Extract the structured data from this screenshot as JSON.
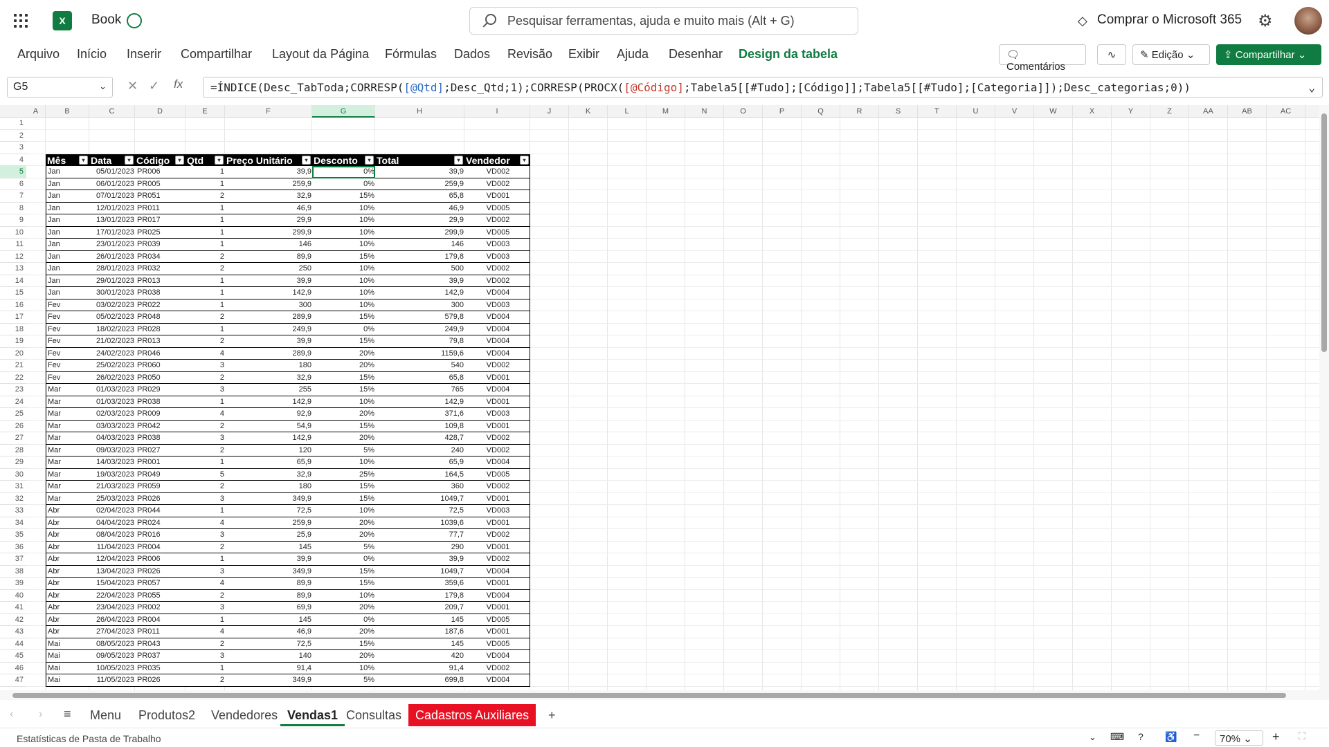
{
  "app": {
    "doc_title": "Book",
    "search_placeholder": "Pesquisar ferramentas, ajuda e muito mais (Alt + G)",
    "buy_label": "Comprar o Microsoft 365"
  },
  "menu": {
    "tabs": [
      "Arquivo",
      "Início",
      "Inserir",
      "Compartilhar",
      "Layout da Página",
      "Fórmulas",
      "Dados",
      "Revisão",
      "Exibir",
      "Ajuda",
      "Desenhar",
      "Design da tabela"
    ],
    "active": "Design da tabela"
  },
  "ribbon": {
    "comments_label": "Comentários",
    "edit_label": "Edição",
    "share_label": "Compartilhar"
  },
  "formula_bar": {
    "name_box": "G5",
    "fx": "fx",
    "formula_parts": [
      "=ÍNDICE(Desc_TabToda;CORRESP(",
      "[@Qtd]",
      ";Desc_Qtd;1);CORRESP(PROCX(",
      "[@Código]",
      ";Tabela5[[#Tudo];[Código]];Tabela5[[#Tudo];[Categoria]]);Desc_categorias;0))"
    ]
  },
  "columns": [
    "A",
    "B",
    "C",
    "D",
    "E",
    "F",
    "G",
    "H",
    "I",
    "J",
    "K",
    "L",
    "M",
    "N",
    "O",
    "P",
    "Q",
    "R",
    "S",
    "T",
    "U",
    "V",
    "W",
    "X",
    "Y",
    "Z",
    "AA",
    "AB",
    "AC"
  ],
  "selected_column": "G",
  "selected_row": 5,
  "table": {
    "headers": [
      "Mês",
      "Data",
      "Código",
      "Qtd",
      "Preço Unitário",
      "Desconto",
      "Total",
      "Vendedor"
    ],
    "rows": [
      [
        "Jan",
        "05/01/2023",
        "PR006",
        "1",
        "39,9",
        "0%",
        "39,9",
        "VD002"
      ],
      [
        "Jan",
        "06/01/2023",
        "PR005",
        "1",
        "259,9",
        "0%",
        "259,9",
        "VD002"
      ],
      [
        "Jan",
        "07/01/2023",
        "PR051",
        "2",
        "32,9",
        "15%",
        "65,8",
        "VD001"
      ],
      [
        "Jan",
        "12/01/2023",
        "PR011",
        "1",
        "46,9",
        "10%",
        "46,9",
        "VD005"
      ],
      [
        "Jan",
        "13/01/2023",
        "PR017",
        "1",
        "29,9",
        "10%",
        "29,9",
        "VD002"
      ],
      [
        "Jan",
        "17/01/2023",
        "PR025",
        "1",
        "299,9",
        "10%",
        "299,9",
        "VD005"
      ],
      [
        "Jan",
        "23/01/2023",
        "PR039",
        "1",
        "146",
        "10%",
        "146",
        "VD003"
      ],
      [
        "Jan",
        "26/01/2023",
        "PR034",
        "2",
        "89,9",
        "15%",
        "179,8",
        "VD003"
      ],
      [
        "Jan",
        "28/01/2023",
        "PR032",
        "2",
        "250",
        "10%",
        "500",
        "VD002"
      ],
      [
        "Jan",
        "29/01/2023",
        "PR013",
        "1",
        "39,9",
        "10%",
        "39,9",
        "VD002"
      ],
      [
        "Jan",
        "30/01/2023",
        "PR038",
        "1",
        "142,9",
        "10%",
        "142,9",
        "VD004"
      ],
      [
        "Fev",
        "03/02/2023",
        "PR022",
        "1",
        "300",
        "10%",
        "300",
        "VD003"
      ],
      [
        "Fev",
        "05/02/2023",
        "PR048",
        "2",
        "289,9",
        "15%",
        "579,8",
        "VD004"
      ],
      [
        "Fev",
        "18/02/2023",
        "PR028",
        "1",
        "249,9",
        "0%",
        "249,9",
        "VD004"
      ],
      [
        "Fev",
        "21/02/2023",
        "PR013",
        "2",
        "39,9",
        "15%",
        "79,8",
        "VD004"
      ],
      [
        "Fev",
        "24/02/2023",
        "PR046",
        "4",
        "289,9",
        "20%",
        "1159,6",
        "VD004"
      ],
      [
        "Fev",
        "25/02/2023",
        "PR060",
        "3",
        "180",
        "20%",
        "540",
        "VD002"
      ],
      [
        "Fev",
        "26/02/2023",
        "PR050",
        "2",
        "32,9",
        "15%",
        "65,8",
        "VD001"
      ],
      [
        "Mar",
        "01/03/2023",
        "PR029",
        "3",
        "255",
        "15%",
        "765",
        "VD004"
      ],
      [
        "Mar",
        "01/03/2023",
        "PR038",
        "1",
        "142,9",
        "10%",
        "142,9",
        "VD001"
      ],
      [
        "Mar",
        "02/03/2023",
        "PR009",
        "4",
        "92,9",
        "20%",
        "371,6",
        "VD003"
      ],
      [
        "Mar",
        "03/03/2023",
        "PR042",
        "2",
        "54,9",
        "15%",
        "109,8",
        "VD001"
      ],
      [
        "Mar",
        "04/03/2023",
        "PR038",
        "3",
        "142,9",
        "20%",
        "428,7",
        "VD002"
      ],
      [
        "Mar",
        "09/03/2023",
        "PR027",
        "2",
        "120",
        "5%",
        "240",
        "VD002"
      ],
      [
        "Mar",
        "14/03/2023",
        "PR001",
        "1",
        "65,9",
        "10%",
        "65,9",
        "VD004"
      ],
      [
        "Mar",
        "19/03/2023",
        "PR049",
        "5",
        "32,9",
        "25%",
        "164,5",
        "VD005"
      ],
      [
        "Mar",
        "21/03/2023",
        "PR059",
        "2",
        "180",
        "15%",
        "360",
        "VD002"
      ],
      [
        "Mar",
        "25/03/2023",
        "PR026",
        "3",
        "349,9",
        "15%",
        "1049,7",
        "VD001"
      ],
      [
        "Abr",
        "02/04/2023",
        "PR044",
        "1",
        "72,5",
        "10%",
        "72,5",
        "VD003"
      ],
      [
        "Abr",
        "04/04/2023",
        "PR024",
        "4",
        "259,9",
        "20%",
        "1039,6",
        "VD001"
      ],
      [
        "Abr",
        "08/04/2023",
        "PR016",
        "3",
        "25,9",
        "20%",
        "77,7",
        "VD002"
      ],
      [
        "Abr",
        "11/04/2023",
        "PR004",
        "2",
        "145",
        "5%",
        "290",
        "VD001"
      ],
      [
        "Abr",
        "12/04/2023",
        "PR006",
        "1",
        "39,9",
        "0%",
        "39,9",
        "VD002"
      ],
      [
        "Abr",
        "13/04/2023",
        "PR026",
        "3",
        "349,9",
        "15%",
        "1049,7",
        "VD004"
      ],
      [
        "Abr",
        "15/04/2023",
        "PR057",
        "4",
        "89,9",
        "15%",
        "359,6",
        "VD001"
      ],
      [
        "Abr",
        "22/04/2023",
        "PR055",
        "2",
        "89,9",
        "10%",
        "179,8",
        "VD004"
      ],
      [
        "Abr",
        "23/04/2023",
        "PR002",
        "3",
        "69,9",
        "20%",
        "209,7",
        "VD001"
      ],
      [
        "Abr",
        "26/04/2023",
        "PR004",
        "1",
        "145",
        "0%",
        "145",
        "VD005"
      ],
      [
        "Abr",
        "27/04/2023",
        "PR011",
        "4",
        "46,9",
        "20%",
        "187,6",
        "VD001"
      ],
      [
        "Mai",
        "08/05/2023",
        "PR043",
        "2",
        "72,5",
        "15%",
        "145",
        "VD005"
      ],
      [
        "Mai",
        "09/05/2023",
        "PR037",
        "3",
        "140",
        "20%",
        "420",
        "VD004"
      ],
      [
        "Mai",
        "10/05/2023",
        "PR035",
        "1",
        "91,4",
        "10%",
        "91,4",
        "VD002"
      ],
      [
        "Mai",
        "11/05/2023",
        "PR026",
        "2",
        "349,9",
        "5%",
        "699,8",
        "VD004"
      ]
    ]
  },
  "sheet_tabs": {
    "items": [
      "Menu",
      "Produtos2",
      "Vendedores",
      "Vendas1",
      "Consultas",
      "Cadastros Auxiliares"
    ],
    "active": "Vendas1",
    "highlighted": "Cadastros Auxiliares",
    "add_label": "+"
  },
  "status": {
    "left_text": "Estatísticas de Pasta de Trabalho",
    "zoom": "70%"
  },
  "colors": {
    "excel_green": "#107c41",
    "highlight_red": "#e81123",
    "table_header": "#000000"
  }
}
